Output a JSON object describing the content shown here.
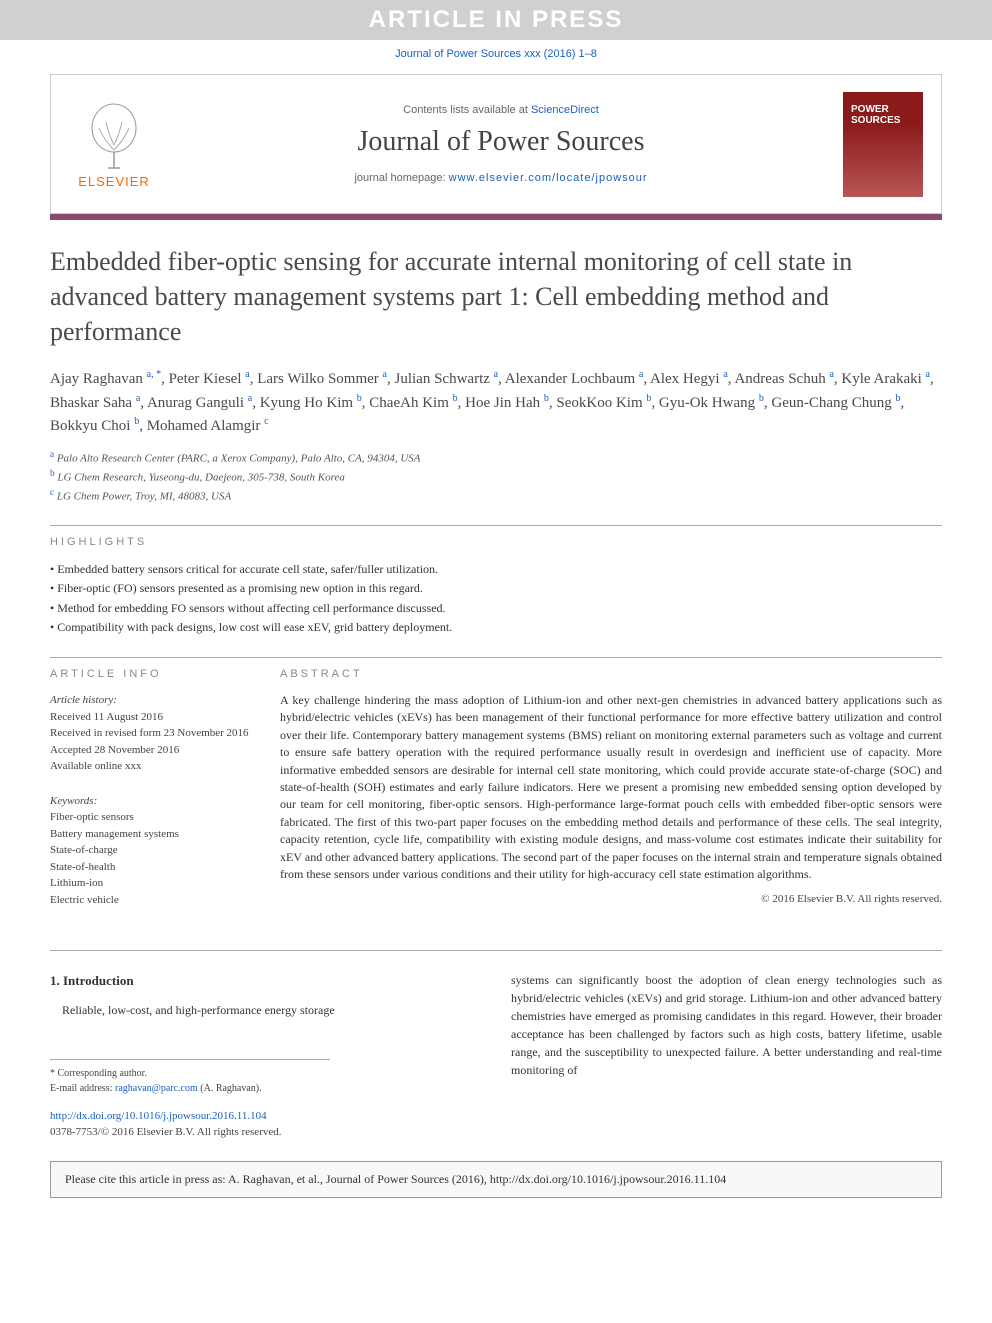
{
  "banner": "ARTICLE IN PRESS",
  "journalRef": "Journal of Power Sources xxx (2016) 1–8",
  "header": {
    "contentsPrefix": "Contents lists available at ",
    "contentsLink": "ScienceDirect",
    "journalName": "Journal of Power Sources",
    "homepagePrefix": "journal homepage: ",
    "homepageLink": "www.elsevier.com/locate/jpowsour",
    "publisher": "ELSEVIER",
    "coverTitle": "POWER SOURCES"
  },
  "title": "Embedded fiber-optic sensing for accurate internal monitoring of cell state in advanced battery management systems part 1: Cell embedding method and performance",
  "authors": [
    {
      "name": "Ajay Raghavan",
      "aff": "a, *"
    },
    {
      "name": "Peter Kiesel",
      "aff": "a"
    },
    {
      "name": "Lars Wilko Sommer",
      "aff": "a"
    },
    {
      "name": "Julian Schwartz",
      "aff": "a"
    },
    {
      "name": "Alexander Lochbaum",
      "aff": "a"
    },
    {
      "name": "Alex Hegyi",
      "aff": "a"
    },
    {
      "name": "Andreas Schuh",
      "aff": "a"
    },
    {
      "name": "Kyle Arakaki",
      "aff": "a"
    },
    {
      "name": "Bhaskar Saha",
      "aff": "a"
    },
    {
      "name": "Anurag Ganguli",
      "aff": "a"
    },
    {
      "name": "Kyung Ho Kim",
      "aff": "b"
    },
    {
      "name": "ChaeAh Kim",
      "aff": "b"
    },
    {
      "name": "Hoe Jin Hah",
      "aff": "b"
    },
    {
      "name": "SeokKoo Kim",
      "aff": "b"
    },
    {
      "name": "Gyu-Ok Hwang",
      "aff": "b"
    },
    {
      "name": "Geun-Chang Chung",
      "aff": "b"
    },
    {
      "name": "Bokkyu Choi",
      "aff": "b"
    },
    {
      "name": "Mohamed Alamgir",
      "aff": "c"
    }
  ],
  "affiliations": [
    {
      "sup": "a",
      "text": "Palo Alto Research Center (PARC, a Xerox Company), Palo Alto, CA, 94304, USA"
    },
    {
      "sup": "b",
      "text": "LG Chem Research, Yuseong-du, Daejeon, 305-738, South Korea"
    },
    {
      "sup": "c",
      "text": "LG Chem Power, Troy, MI, 48083, USA"
    }
  ],
  "highlightsLabel": "HIGHLIGHTS",
  "highlights": [
    "Embedded battery sensors critical for accurate cell state, safer/fuller utilization.",
    "Fiber-optic (FO) sensors presented as a promising new option in this regard.",
    "Method for embedding FO sensors without affecting cell performance discussed.",
    "Compatibility with pack designs, low cost will ease xEV, grid battery deployment."
  ],
  "articleInfoLabel": "ARTICLE INFO",
  "articleHistory": {
    "label": "Article history:",
    "received": "Received 11 August 2016",
    "revised": "Received in revised form 23 November 2016",
    "accepted": "Accepted 28 November 2016",
    "online": "Available online xxx"
  },
  "keywordsLabel": "Keywords:",
  "keywords": [
    "Fiber-optic sensors",
    "Battery management systems",
    "State-of-charge",
    "State-of-health",
    "Lithium-ion",
    "Electric vehicle"
  ],
  "abstractLabel": "ABSTRACT",
  "abstract": "A key challenge hindering the mass adoption of Lithium-ion and other next-gen chemistries in advanced battery applications such as hybrid/electric vehicles (xEVs) has been management of their functional performance for more effective battery utilization and control over their life. Contemporary battery management systems (BMS) reliant on monitoring external parameters such as voltage and current to ensure safe battery operation with the required performance usually result in overdesign and inefficient use of capacity. More informative embedded sensors are desirable for internal cell state monitoring, which could provide accurate state-of-charge (SOC) and state-of-health (SOH) estimates and early failure indicators. Here we present a promising new embedded sensing option developed by our team for cell monitoring, fiber-optic sensors. High-performance large-format pouch cells with embedded fiber-optic sensors were fabricated. The first of this two-part paper focuses on the embedding method details and performance of these cells. The seal integrity, capacity retention, cycle life, compatibility with existing module designs, and mass-volume cost estimates indicate their suitability for xEV and other advanced battery applications. The second part of the paper focuses on the internal strain and temperature signals obtained from these sensors under various conditions and their utility for high-accuracy cell state estimation algorithms.",
  "copyright": "© 2016 Elsevier B.V. All rights reserved.",
  "introHeading": "1. Introduction",
  "introCol1": "Reliable, low-cost, and high-performance energy storage",
  "introCol2": "systems can significantly boost the adoption of clean energy technologies such as hybrid/electric vehicles (xEVs) and grid storage. Lithium-ion and other advanced battery chemistries have emerged as promising candidates in this regard. However, their broader acceptance has been challenged by factors such as high costs, battery lifetime, usable range, and the susceptibility to unexpected failure. A better understanding and real-time monitoring of",
  "correspondingLabel": "* Corresponding author.",
  "emailLabel": "E-mail address: ",
  "email": "raghavan@parc.com",
  "emailName": " (A. Raghavan).",
  "doi": "http://dx.doi.org/10.1016/j.jpowsour.2016.11.104",
  "issn": "0378-7753/© 2016 Elsevier B.V. All rights reserved.",
  "citeBox": "Please cite this article in press as: A. Raghavan, et al., Journal of Power Sources (2016), http://dx.doi.org/10.1016/j.jpowsour.2016.11.104"
}
